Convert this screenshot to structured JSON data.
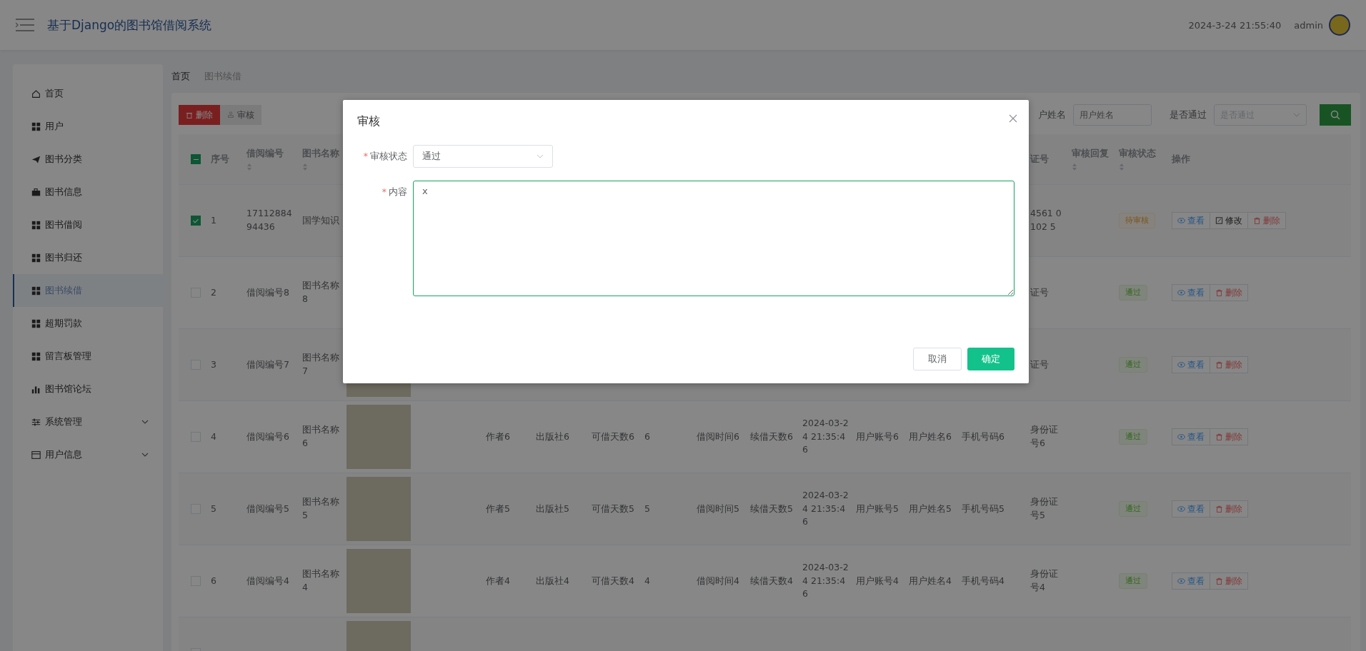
{
  "header": {
    "title": "基于Django的图书馆借阅系统",
    "time": "2024-3-24 21:55:40",
    "user": "admin"
  },
  "sidebar": {
    "items": [
      {
        "label": "首页",
        "kind": "home",
        "selected": false,
        "expandable": false
      },
      {
        "label": "用户",
        "kind": "grid",
        "selected": false,
        "expandable": false
      },
      {
        "label": "图书分类",
        "kind": "plane",
        "selected": false,
        "expandable": false
      },
      {
        "label": "图书信息",
        "kind": "briefcase",
        "selected": false,
        "expandable": false
      },
      {
        "label": "图书借阅",
        "kind": "grid",
        "selected": false,
        "expandable": false
      },
      {
        "label": "图书归还",
        "kind": "grid",
        "selected": false,
        "expandable": false
      },
      {
        "label": "图书续借",
        "kind": "grid",
        "selected": true,
        "expandable": false
      },
      {
        "label": "超期罚款",
        "kind": "grid",
        "selected": false,
        "expandable": false
      },
      {
        "label": "留言板管理",
        "kind": "grid",
        "selected": false,
        "expandable": false
      },
      {
        "label": "图书馆论坛",
        "kind": "chart",
        "selected": false,
        "expandable": false
      },
      {
        "label": "系统管理",
        "kind": "sliders",
        "selected": false,
        "expandable": true
      },
      {
        "label": "用户信息",
        "kind": "card",
        "selected": false,
        "expandable": true
      }
    ]
  },
  "breadcrumb": [
    "首页",
    "图书续借"
  ],
  "toolbar": {
    "buttons": [
      {
        "label": "删除",
        "kind": "danger"
      },
      {
        "label": "审核",
        "kind": "plain"
      }
    ]
  },
  "search": {
    "filters": [
      {
        "label": "户姓名",
        "placeholder": "用户姓名",
        "kind": "input"
      },
      {
        "label": "是否通过",
        "placeholder": "是否通过",
        "kind": "select"
      }
    ]
  },
  "table": {
    "select_all": {
      "indeterminate": true
    },
    "columns": [
      {
        "label": "序号",
        "sortable": false
      },
      {
        "label": "借阅编号",
        "sortable": true
      },
      {
        "label": "图书名称",
        "sortable": true
      },
      null,
      null,
      null,
      null,
      null,
      null,
      null,
      null,
      null,
      null,
      null,
      {
        "label": "证号",
        "sortable": false
      },
      {
        "label": "审核回复",
        "sortable": true
      },
      {
        "label": "审核状态",
        "sortable": true
      },
      {
        "label": "操作",
        "sortable": false
      }
    ],
    "rows": [
      {
        "checked": true,
        "index": "1",
        "borrow_no": "1711288494436",
        "book_name": "国学知识",
        "id_no": "4561 0102 5",
        "status": {
          "label": "待审核",
          "kind": "pending"
        },
        "actions": [
          {
            "label": "查看",
            "kind": "view"
          },
          {
            "label": "修改",
            "kind": "edit"
          },
          {
            "label": "删除",
            "kind": "delete"
          }
        ]
      },
      {
        "checked": false,
        "index": "2",
        "borrow_no": "借阅编号8",
        "book_name": "图书名称8",
        "id_no": "证号",
        "status": {
          "label": "通过",
          "kind": "passed"
        },
        "actions": [
          {
            "label": "查看",
            "kind": "view"
          },
          {
            "label": "删除",
            "kind": "delete"
          }
        ]
      },
      {
        "checked": false,
        "index": "3",
        "borrow_no": "借阅编号7",
        "book_name": "图书名称7",
        "cover": true,
        "id_no": "证号",
        "status": {
          "label": "通过",
          "kind": "passed"
        },
        "actions": [
          {
            "label": "查看",
            "kind": "view"
          },
          {
            "label": "删除",
            "kind": "delete"
          }
        ]
      },
      {
        "checked": false,
        "index": "4",
        "borrow_no": "借阅编号6",
        "book_name": "图书名称6",
        "cover": true,
        "author": "作者6",
        "publisher": "出版社6",
        "days": "可借天数6",
        "number": "6",
        "borrow_time": "借阅时间6",
        "renew_days": "续借天数6",
        "date": "2024-03-24 21:35:46",
        "account": "用户账号6",
        "user_name": "用户姓名6",
        "phone": "手机号码6",
        "id_no": "身份证号6",
        "status": {
          "label": "通过",
          "kind": "passed"
        },
        "actions": [
          {
            "label": "查看",
            "kind": "view"
          },
          {
            "label": "删除",
            "kind": "delete"
          }
        ]
      },
      {
        "checked": false,
        "index": "5",
        "borrow_no": "借阅编号5",
        "book_name": "图书名称5",
        "cover": true,
        "author": "作者5",
        "publisher": "出版社5",
        "days": "可借天数5",
        "number": "5",
        "borrow_time": "借阅时间5",
        "renew_days": "续借天数5",
        "date": "2024-03-24 21:35:46",
        "account": "用户账号5",
        "user_name": "用户姓名5",
        "phone": "手机号码5",
        "id_no": "身份证号5",
        "status": {
          "label": "通过",
          "kind": "passed"
        },
        "actions": [
          {
            "label": "查看",
            "kind": "view"
          },
          {
            "label": "删除",
            "kind": "delete"
          }
        ]
      },
      {
        "checked": false,
        "index": "6",
        "borrow_no": "借阅编号4",
        "book_name": "图书名称4",
        "cover": true,
        "author": "作者4",
        "publisher": "出版社4",
        "days": "可借天数4",
        "number": "4",
        "borrow_time": "借阅时间4",
        "renew_days": "续借天数4",
        "date": "2024-03-24 21:35:46",
        "account": "用户账号4",
        "user_name": "用户姓名4",
        "phone": "手机号码4",
        "id_no": "身份证号4",
        "status": {
          "label": "通过",
          "kind": "passed"
        },
        "actions": [
          {
            "label": "查看",
            "kind": "view"
          },
          {
            "label": "删除",
            "kind": "delete"
          }
        ]
      },
      {
        "checked": false,
        "cover": true
      }
    ]
  },
  "dialog": {
    "title": "审核",
    "fields": [
      {
        "label": "审核状态",
        "required_mark": "*",
        "kind": "select",
        "value": "通过"
      },
      {
        "label": "内容",
        "required_mark": "*",
        "kind": "textarea",
        "value": "x"
      }
    ],
    "buttons": [
      {
        "label": "取消",
        "kind": "plain"
      },
      {
        "label": "确定",
        "kind": "primary"
      }
    ]
  }
}
